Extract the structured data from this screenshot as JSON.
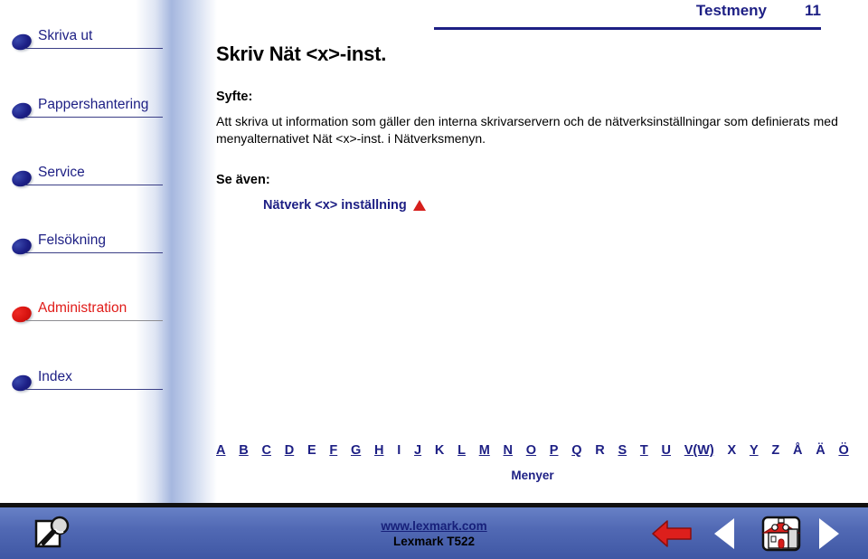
{
  "header": {
    "title": "Testmeny",
    "page_number": "11"
  },
  "sidebar": {
    "items": [
      {
        "label": "Skriva ut",
        "color": "blue",
        "icon": "bullet-icon"
      },
      {
        "label": "Pappershantering",
        "color": "blue",
        "icon": "bullet-icon"
      },
      {
        "label": "Service",
        "color": "blue",
        "icon": "bullet-icon"
      },
      {
        "label": "Felsökning",
        "color": "blue",
        "icon": "bullet-icon"
      },
      {
        "label": "Administration",
        "color": "red",
        "icon": "bullet-icon"
      },
      {
        "label": "Index",
        "color": "blue",
        "icon": "bullet-icon"
      }
    ]
  },
  "main": {
    "doc_title": "Skriv Nät <x>-inst.",
    "purpose_heading": "Syfte:",
    "purpose_body": "Att skriva ut information som gäller den interna skrivarservern och de nätverksinställningar som definierats med menyalternativet Nät  <x>-inst. i Nätverksmenyn.",
    "seealso_heading": "Se även:",
    "seealso_link": "Nätverk <x> inställning",
    "seealso_marker_icon": "triangle-up-icon"
  },
  "alphabet_index": {
    "letters": [
      {
        "label": "A",
        "underlined": true
      },
      {
        "label": "B",
        "underlined": true
      },
      {
        "label": "C",
        "underlined": true
      },
      {
        "label": "D",
        "underlined": true
      },
      {
        "label": "E",
        "underlined": false
      },
      {
        "label": "F",
        "underlined": true
      },
      {
        "label": "G",
        "underlined": true
      },
      {
        "label": "H",
        "underlined": true
      },
      {
        "label": "I",
        "underlined": false
      },
      {
        "label": "J",
        "underlined": true
      },
      {
        "label": "K",
        "underlined": false
      },
      {
        "label": "L",
        "underlined": true
      },
      {
        "label": "M",
        "underlined": true
      },
      {
        "label": "N",
        "underlined": true
      },
      {
        "label": "O",
        "underlined": true
      },
      {
        "label": "P",
        "underlined": true
      },
      {
        "label": "Q",
        "underlined": true
      },
      {
        "label": "R",
        "underlined": false
      },
      {
        "label": "S",
        "underlined": true
      },
      {
        "label": "T",
        "underlined": true
      },
      {
        "label": "U",
        "underlined": true
      },
      {
        "label": "V(W)",
        "underlined": true
      },
      {
        "label": "X",
        "underlined": false
      },
      {
        "label": "Y",
        "underlined": true
      },
      {
        "label": "Z",
        "underlined": false
      },
      {
        "label": "Å",
        "underlined": false
      },
      {
        "label": "Ä",
        "underlined": false
      },
      {
        "label": "Ö",
        "underlined": true
      }
    ],
    "caption": "Menyer"
  },
  "footer": {
    "url": "www.lexmark.com",
    "model": "Lexmark T522",
    "search_icon": "search-page-icon",
    "back_icon": "back-arrow-icon",
    "prev_icon": "previous-page-icon",
    "home_icon": "home-icon",
    "next_icon": "next-page-icon"
  },
  "colors": {
    "navy": "#1d1f84",
    "red": "#e01b18",
    "footer_blue": "#5169b4",
    "link_navy": "#17207a"
  }
}
